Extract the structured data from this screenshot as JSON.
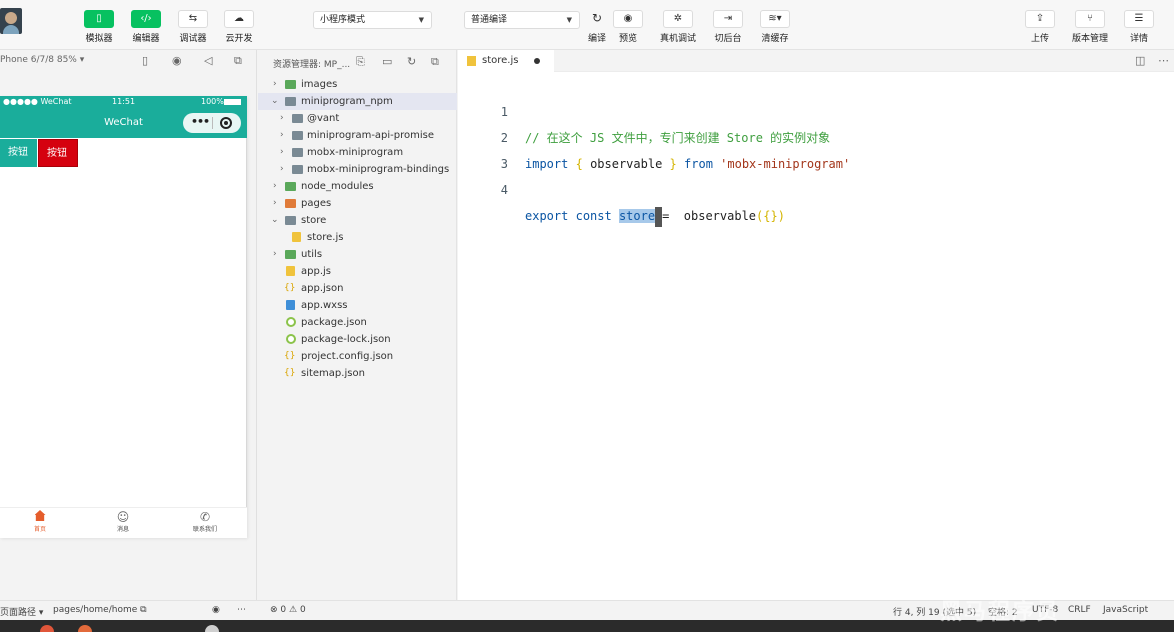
{
  "toolbar": {
    "buttons": [
      {
        "label": "模拟器",
        "icon": "phone-icon"
      },
      {
        "label": "编辑器",
        "icon": "code-icon"
      },
      {
        "label": "调试器",
        "icon": "swap-icon"
      },
      {
        "label": "云开发",
        "icon": "cloud-icon"
      },
      {
        "label": "编译",
        "icon": "refresh-icon"
      },
      {
        "label": "预览",
        "icon": "eye-icon"
      },
      {
        "label": "真机调试",
        "icon": "bug-icon"
      },
      {
        "label": "切后台",
        "icon": "switch-icon"
      },
      {
        "label": "清缓存",
        "icon": "layers-icon"
      },
      {
        "label": "上传",
        "icon": "upload-icon"
      },
      {
        "label": "版本管理",
        "icon": "branch-icon"
      },
      {
        "label": "详情",
        "icon": "menu-icon"
      }
    ],
    "mode_select": "小程序模式",
    "compile_select": "普通编译",
    "accent_color": "#07c160"
  },
  "simulator": {
    "device_label": "Phone 6/7/8 85%",
    "status": {
      "carrier": "●●●●● WeChat",
      "time": "11:51",
      "battery": "100%"
    },
    "nav_title": "WeChat",
    "buttons": [
      "按钮",
      "按钮"
    ],
    "tabs": [
      {
        "label": "首页",
        "icon": "home-icon"
      },
      {
        "label": "消息",
        "icon": "chat-icon"
      },
      {
        "label": "联系我们",
        "icon": "phone-call-icon"
      }
    ],
    "theme_color": "#1aad9b",
    "danger_color": "#d5010f"
  },
  "explorer": {
    "title": "资源管理器: MP_...",
    "tree": [
      {
        "label": "images",
        "type": "folder-green",
        "expanded": false
      },
      {
        "label": "miniprogram_npm",
        "type": "folder",
        "expanded": true
      },
      {
        "label": "@vant",
        "type": "folder",
        "expanded": false
      },
      {
        "label": "miniprogram-api-promise",
        "type": "folder",
        "expanded": false
      },
      {
        "label": "mobx-miniprogram",
        "type": "folder",
        "expanded": false
      },
      {
        "label": "mobx-miniprogram-bindings",
        "type": "folder",
        "expanded": false
      },
      {
        "label": "node_modules",
        "type": "folder-green",
        "expanded": false
      },
      {
        "label": "pages",
        "type": "folder-orange",
        "expanded": false
      },
      {
        "label": "store",
        "type": "folder",
        "expanded": true
      },
      {
        "label": "store.js",
        "type": "js"
      },
      {
        "label": "utils",
        "type": "folder-green",
        "expanded": false
      },
      {
        "label": "app.js",
        "type": "js"
      },
      {
        "label": "app.json",
        "type": "json"
      },
      {
        "label": "app.wxss",
        "type": "css"
      },
      {
        "label": "package.json",
        "type": "pkg"
      },
      {
        "label": "package-lock.json",
        "type": "pkg"
      },
      {
        "label": "project.config.json",
        "type": "json"
      },
      {
        "label": "sitemap.json",
        "type": "json"
      }
    ]
  },
  "editor": {
    "tab_name": "store.js",
    "lines": [
      {
        "no": "1",
        "comment": "// 在这个 JS 文件中，专门来创建 Store 的实例对象"
      },
      {
        "no": "2",
        "kw": "import",
        "open": "{",
        "ident": "observable",
        "close": "}",
        "kw2": "from",
        "str": "'mobx-miniprogram'"
      },
      {
        "no": "3"
      },
      {
        "no": "4",
        "kw": "export",
        "kw2": "const",
        "selected": "store",
        "op": "=",
        "call": "observable",
        "args": "({})"
      }
    ]
  },
  "statusbar": {
    "page_path_label": "页面路径",
    "page_path": "pages/home/home",
    "errors": "0",
    "warnings": "0",
    "cursor_pos": "行 4, 列 19 (选中 5)",
    "spaces": "空格: 2",
    "encoding": "UTF-8",
    "eol": "CRLF",
    "language": "JavaScript"
  },
  "watermark": "黑马程序员"
}
